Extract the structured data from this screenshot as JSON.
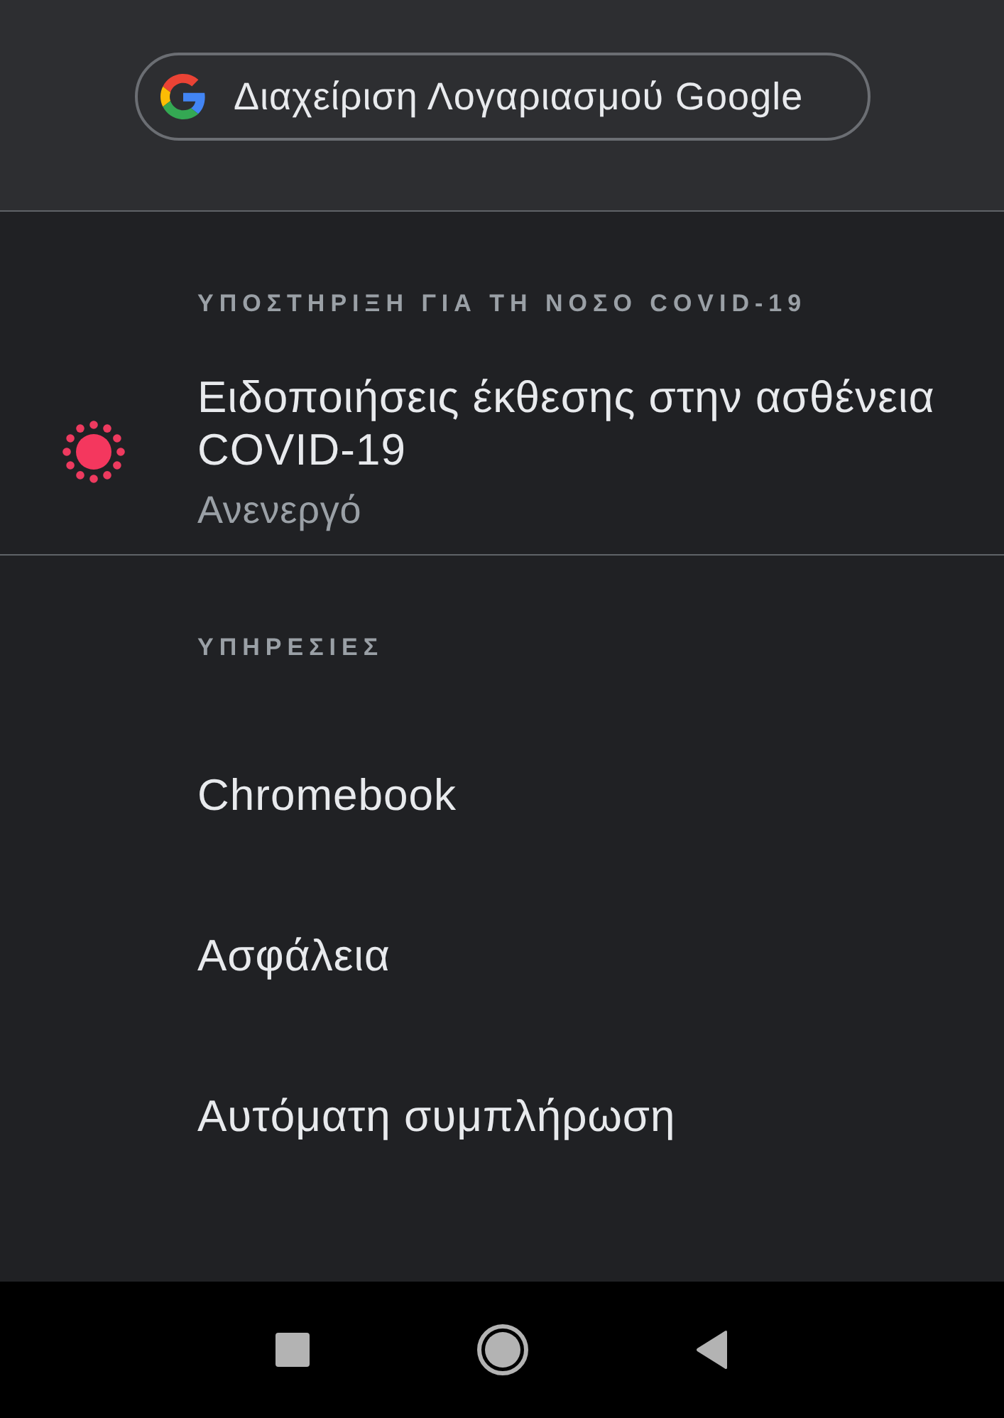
{
  "account_button": {
    "label": "Διαχείριση Λογαριασμού Google"
  },
  "sections": [
    {
      "header": "ΥΠΟΣΤΗΡΙΞΗ ΓΙΑ ΤΗ ΝΟΣΟ COVID-19",
      "items": [
        {
          "kind": "alert",
          "title": "Ειδοποιήσεις έκθεσης στην ασθένεια COVID-19",
          "subtitle": "Ανενεργό"
        }
      ]
    },
    {
      "header": "ΥΠΗΡΕΣΙΕΣ",
      "items": [
        {
          "kind": "plain",
          "title": "Chromebook"
        },
        {
          "kind": "plain",
          "title": "Ασφάλεια"
        },
        {
          "kind": "plain",
          "title": "Αυτόματη συμπλήρωση"
        }
      ]
    }
  ]
}
